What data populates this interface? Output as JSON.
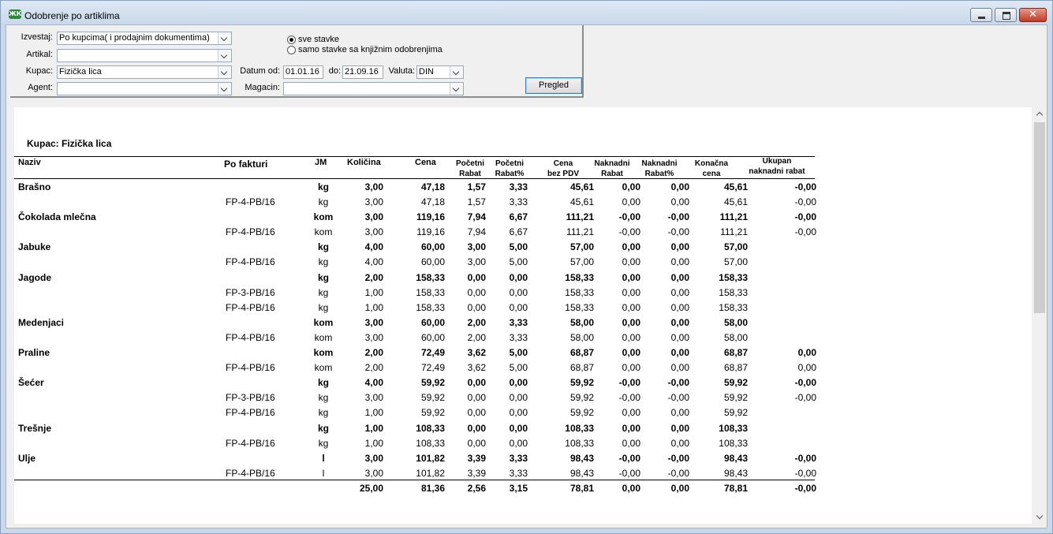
{
  "window": {
    "title": "Odobrenje po artiklima",
    "icon": "app-logo-icon",
    "close_glyph": "✕"
  },
  "filters": {
    "izvestaj_label": "Izvestaj:",
    "izvestaj_value": "Po kupcima( i prodajnim dokumentima)",
    "artikal_label": "Artikal:",
    "artikal_value": "",
    "kupac_label": "Kupac:",
    "kupac_value": "Fizička lica",
    "agent_label": "Agent:",
    "agent_value": "",
    "datum_od_label": "Datum od:",
    "datum_od_value": "01.01.16",
    "do_label": "do:",
    "do_value": "21.09.16",
    "valuta_label": "Valuta:",
    "valuta_value": "DIN",
    "magacin_label": "Magacin:",
    "magacin_value": "",
    "radio_all_label": "sve stavke",
    "radio_booked_label": "samo stavke sa knjižnim odobrenjima",
    "radio_selected": "all",
    "pregled_label": "Pregled"
  },
  "report": {
    "kupac_heading": "Kupac: Fizička lica",
    "headers": {
      "naziv": "Naziv",
      "po_fakturi": "Po fakturi",
      "jm": "JM",
      "kolicina": "Količina",
      "cena": "Cena",
      "pocetni_rabat_1": "Početni",
      "pocetni_rabat_2": "Rabat",
      "pocetni_rabat_pct_1": "Početni",
      "pocetni_rabat_pct_2": "Rabat%",
      "cena_bez_pdv_1": "Cena",
      "cena_bez_pdv_2": "bez PDV",
      "naknadni_rabat_1": "Naknadni",
      "naknadni_rabat_2": "Rabat",
      "naknadni_rabat_pct_1": "Naknadni",
      "naknadni_rabat_pct_2": "Rabat%",
      "konacna_cena_1": "Konačna",
      "konacna_cena_2": "cena",
      "ukupan_1": "Ukupan",
      "ukupan_2": "naknadni rabat"
    },
    "rows": [
      {
        "bold": true,
        "naziv": "Brašno",
        "faktura": "",
        "jm": "kg",
        "kol": "3,00",
        "cena": "47,18",
        "prab": "1,57",
        "prabp": "3,33",
        "bezpdv": "45,61",
        "nrab": "0,00",
        "nrabp": "0,00",
        "kcena": "45,61",
        "ukupno": "-0,00"
      },
      {
        "bold": false,
        "naziv": "",
        "faktura": "FP-4-PB/16",
        "jm": "kg",
        "kol": "3,00",
        "cena": "47,18",
        "prab": "1,57",
        "prabp": "3,33",
        "bezpdv": "45,61",
        "nrab": "0,00",
        "nrabp": "0,00",
        "kcena": "45,61",
        "ukupno": "-0,00"
      },
      {
        "bold": true,
        "naziv": "Čokolada mlečna",
        "faktura": "",
        "jm": "kom",
        "kol": "3,00",
        "cena": "119,16",
        "prab": "7,94",
        "prabp": "6,67",
        "bezpdv": "111,21",
        "nrab": "-0,00",
        "nrabp": "-0,00",
        "kcena": "111,21",
        "ukupno": "-0,00"
      },
      {
        "bold": false,
        "naziv": "",
        "faktura": "FP-4-PB/16",
        "jm": "kom",
        "kol": "3,00",
        "cena": "119,16",
        "prab": "7,94",
        "prabp": "6,67",
        "bezpdv": "111,21",
        "nrab": "-0,00",
        "nrabp": "-0,00",
        "kcena": "111,21",
        "ukupno": "-0,00"
      },
      {
        "bold": true,
        "naziv": "Jabuke",
        "faktura": "",
        "jm": "kg",
        "kol": "4,00",
        "cena": "60,00",
        "prab": "3,00",
        "prabp": "5,00",
        "bezpdv": "57,00",
        "nrab": "0,00",
        "nrabp": "0,00",
        "kcena": "57,00",
        "ukupno": ""
      },
      {
        "bold": false,
        "naziv": "",
        "faktura": "FP-4-PB/16",
        "jm": "kg",
        "kol": "4,00",
        "cena": "60,00",
        "prab": "3,00",
        "prabp": "5,00",
        "bezpdv": "57,00",
        "nrab": "0,00",
        "nrabp": "0,00",
        "kcena": "57,00",
        "ukupno": ""
      },
      {
        "bold": true,
        "naziv": "Jagode",
        "faktura": "",
        "jm": "kg",
        "kol": "2,00",
        "cena": "158,33",
        "prab": "0,00",
        "prabp": "0,00",
        "bezpdv": "158,33",
        "nrab": "0,00",
        "nrabp": "0,00",
        "kcena": "158,33",
        "ukupno": ""
      },
      {
        "bold": false,
        "naziv": "",
        "faktura": "FP-3-PB/16",
        "jm": "kg",
        "kol": "1,00",
        "cena": "158,33",
        "prab": "0,00",
        "prabp": "0,00",
        "bezpdv": "158,33",
        "nrab": "0,00",
        "nrabp": "0,00",
        "kcena": "158,33",
        "ukupno": ""
      },
      {
        "bold": false,
        "naziv": "",
        "faktura": "FP-4-PB/16",
        "jm": "kg",
        "kol": "1,00",
        "cena": "158,33",
        "prab": "0,00",
        "prabp": "0,00",
        "bezpdv": "158,33",
        "nrab": "0,00",
        "nrabp": "0,00",
        "kcena": "158,33",
        "ukupno": ""
      },
      {
        "bold": true,
        "naziv": "Medenjaci",
        "faktura": "",
        "jm": "kom",
        "kol": "3,00",
        "cena": "60,00",
        "prab": "2,00",
        "prabp": "3,33",
        "bezpdv": "58,00",
        "nrab": "0,00",
        "nrabp": "0,00",
        "kcena": "58,00",
        "ukupno": ""
      },
      {
        "bold": false,
        "naziv": "",
        "faktura": "FP-4-PB/16",
        "jm": "kom",
        "kol": "3,00",
        "cena": "60,00",
        "prab": "2,00",
        "prabp": "3,33",
        "bezpdv": "58,00",
        "nrab": "0,00",
        "nrabp": "0,00",
        "kcena": "58,00",
        "ukupno": ""
      },
      {
        "bold": true,
        "naziv": "Praline",
        "faktura": "",
        "jm": "kom",
        "kol": "2,00",
        "cena": "72,49",
        "prab": "3,62",
        "prabp": "5,00",
        "bezpdv": "68,87",
        "nrab": "0,00",
        "nrabp": "0,00",
        "kcena": "68,87",
        "ukupno": "0,00"
      },
      {
        "bold": false,
        "naziv": "",
        "faktura": "FP-4-PB/16",
        "jm": "kom",
        "kol": "2,00",
        "cena": "72,49",
        "prab": "3,62",
        "prabp": "5,00",
        "bezpdv": "68,87",
        "nrab": "0,00",
        "nrabp": "0,00",
        "kcena": "68,87",
        "ukupno": "0,00"
      },
      {
        "bold": true,
        "naziv": "Šećer",
        "faktura": "",
        "jm": "kg",
        "kol": "4,00",
        "cena": "59,92",
        "prab": "0,00",
        "prabp": "0,00",
        "bezpdv": "59,92",
        "nrab": "-0,00",
        "nrabp": "-0,00",
        "kcena": "59,92",
        "ukupno": "-0,00"
      },
      {
        "bold": false,
        "naziv": "",
        "faktura": "FP-3-PB/16",
        "jm": "kg",
        "kol": "3,00",
        "cena": "59,92",
        "prab": "0,00",
        "prabp": "0,00",
        "bezpdv": "59,92",
        "nrab": "-0,00",
        "nrabp": "-0,00",
        "kcena": "59,92",
        "ukupno": "-0,00"
      },
      {
        "bold": false,
        "naziv": "",
        "faktura": "FP-4-PB/16",
        "jm": "kg",
        "kol": "1,00",
        "cena": "59,92",
        "prab": "0,00",
        "prabp": "0,00",
        "bezpdv": "59,92",
        "nrab": "0,00",
        "nrabp": "0,00",
        "kcena": "59,92",
        "ukupno": ""
      },
      {
        "bold": true,
        "naziv": "Trešnje",
        "faktura": "",
        "jm": "kg",
        "kol": "1,00",
        "cena": "108,33",
        "prab": "0,00",
        "prabp": "0,00",
        "bezpdv": "108,33",
        "nrab": "0,00",
        "nrabp": "0,00",
        "kcena": "108,33",
        "ukupno": ""
      },
      {
        "bold": false,
        "naziv": "",
        "faktura": "FP-4-PB/16",
        "jm": "kg",
        "kol": "1,00",
        "cena": "108,33",
        "prab": "0,00",
        "prabp": "0,00",
        "bezpdv": "108,33",
        "nrab": "0,00",
        "nrabp": "0,00",
        "kcena": "108,33",
        "ukupno": ""
      },
      {
        "bold": true,
        "naziv": "Ulje",
        "faktura": "",
        "jm": "l",
        "kol": "3,00",
        "cena": "101,82",
        "prab": "3,39",
        "prabp": "3,33",
        "bezpdv": "98,43",
        "nrab": "-0,00",
        "nrabp": "-0,00",
        "kcena": "98,43",
        "ukupno": "-0,00"
      },
      {
        "bold": false,
        "naziv": "",
        "faktura": "FP-4-PB/16",
        "jm": "l",
        "kol": "3,00",
        "cena": "101,82",
        "prab": "3,39",
        "prabp": "3,33",
        "bezpdv": "98,43",
        "nrab": "-0,00",
        "nrabp": "-0,00",
        "kcena": "98,43",
        "ukupno": "-0,00"
      }
    ],
    "totals": {
      "kol": "25,00",
      "cena": "81,36",
      "prab": "2,56",
      "prabp": "3,15",
      "bezpdv": "78,81",
      "nrab": "0,00",
      "nrabp": "0,00",
      "kcena": "78,81",
      "ukupno": "-0,00"
    }
  }
}
